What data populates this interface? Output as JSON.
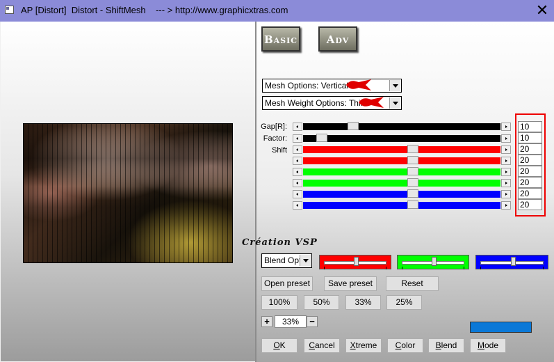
{
  "window": {
    "title": "AP [Distort]  Distort - ShiftMesh    --- > http://www.graphicxtras.com",
    "close_symbol": "✕"
  },
  "tabs": {
    "basic": "Basic",
    "adv": "Adv"
  },
  "mesh_options": {
    "selected": "Mesh Options: Vertical"
  },
  "mesh_weight_options": {
    "selected": "Mesh Weight Options: Thin"
  },
  "params": {
    "gap_label": "Gap[R]:",
    "factor_label": "Factor:",
    "shift_label": "Shift",
    "sliders": [
      {
        "name": "gap",
        "value": "10",
        "color": "#000000",
        "fraction": 0.24
      },
      {
        "name": "factor",
        "value": "10",
        "color": "#000000",
        "fraction": 0.07
      },
      {
        "name": "shift-1",
        "value": "20",
        "color": "#ff0000",
        "fraction": 0.56
      },
      {
        "name": "shift-2",
        "value": "20",
        "color": "#ff0000",
        "fraction": 0.56
      },
      {
        "name": "shift-3",
        "value": "20",
        "color": "#00ff00",
        "fraction": 0.56
      },
      {
        "name": "shift-4",
        "value": "20",
        "color": "#00ff00",
        "fraction": 0.56
      },
      {
        "name": "shift-5",
        "value": "20",
        "color": "#0000ff",
        "fraction": 0.56
      },
      {
        "name": "shift-6",
        "value": "20",
        "color": "#0000ff",
        "fraction": 0.56
      }
    ]
  },
  "watermark": "Création VSP",
  "blend": {
    "selected": "Blend Optio",
    "bars": [
      {
        "name": "red",
        "color": "#ff0000",
        "fraction": 0.5
      },
      {
        "name": "green",
        "color": "#00ff00",
        "fraction": 0.5
      },
      {
        "name": "blue",
        "color": "#0000ff",
        "fraction": 0.5
      }
    ]
  },
  "preset": {
    "open": "Open preset",
    "save": "Save preset",
    "reset": "Reset"
  },
  "zoom_buttons": [
    "100%",
    "50%",
    "33%",
    "25%"
  ],
  "zoom": {
    "plus": "+",
    "value": "33%",
    "minus": "−"
  },
  "color_swatch": "#0a78d7",
  "bottom": {
    "ok_u": "O",
    "ok_r": "K",
    "cancel_u": "C",
    "cancel_r": "ancel",
    "xtreme_u": "X",
    "xtreme_r": "treme",
    "color_u": "C",
    "color_r": "olor",
    "blend_u": "B",
    "blend_r": "lend",
    "mode_u": "M",
    "mode_r": "ode"
  }
}
